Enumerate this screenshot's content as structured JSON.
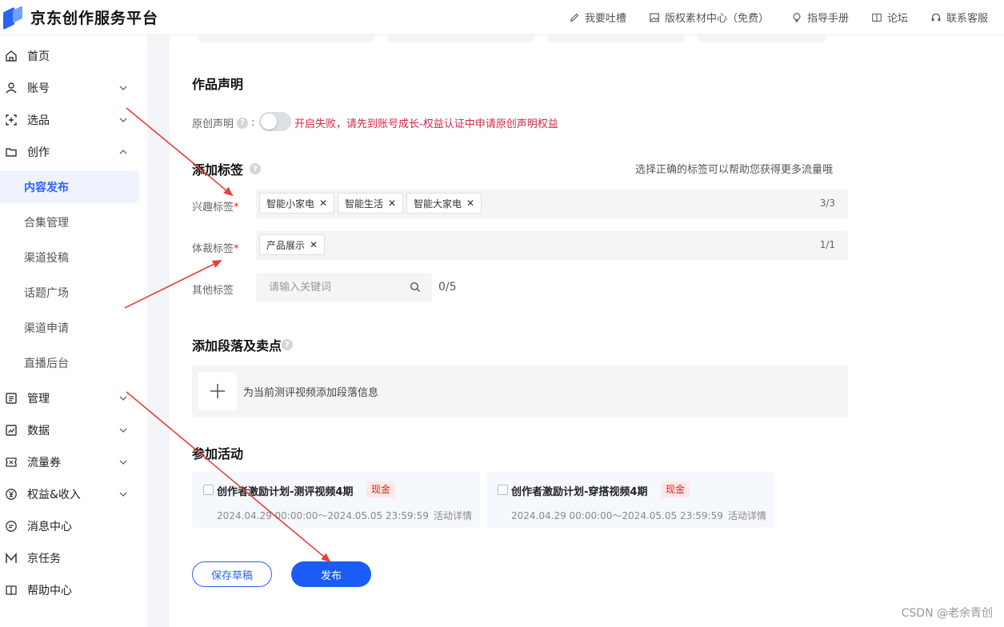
{
  "header": {
    "logo_text": "京东创作服务平台",
    "nav": [
      {
        "icon": "pencil-icon",
        "label": "我要吐槽"
      },
      {
        "icon": "image-icon",
        "label": "版权素材中心（免费）"
      },
      {
        "icon": "bulb-icon",
        "label": "指导手册"
      },
      {
        "icon": "book-icon",
        "label": "论坛"
      },
      {
        "icon": "headset-icon",
        "label": "联系客服"
      }
    ]
  },
  "sidebar": {
    "items": [
      {
        "label": "首页",
        "icon": "home-icon"
      },
      {
        "label": "账号",
        "icon": "user-icon"
      },
      {
        "label": "选品",
        "icon": "scan-icon"
      },
      {
        "label": "创作",
        "icon": "folder-icon"
      },
      {
        "label": "管理",
        "icon": "list-icon"
      },
      {
        "label": "数据",
        "icon": "chart-icon"
      },
      {
        "label": "流量券",
        "icon": "ticket-icon"
      },
      {
        "label": "权益&收入",
        "icon": "yen-icon"
      },
      {
        "label": "消息中心",
        "icon": "message-icon"
      },
      {
        "label": "京任务",
        "icon": "m-icon"
      },
      {
        "label": "帮助中心",
        "icon": "book-icon"
      }
    ],
    "sub_items": [
      "内容发布",
      "合集管理",
      "渠道投稿",
      "话题广场",
      "渠道申请",
      "直播后台"
    ]
  },
  "declaration": {
    "title": "作品声明",
    "original_label": "原创声明",
    "colon": ":",
    "warning": "开启失败，请先到账号成长-权益认证中申请原创声明权益"
  },
  "tags": {
    "title": "添加标签",
    "hint": "选择正确的标签可以帮助您获得更多流量哦",
    "interest_label": "兴趣标签",
    "interest_tags": [
      "智能小家电",
      "智能生活",
      "智能大家电"
    ],
    "interest_count": "3/3",
    "genre_label": "体裁标签",
    "genre_tags": [
      "产品展示"
    ],
    "genre_count": "1/1",
    "other_label": "其他标签",
    "other_placeholder": "请输入关键词",
    "other_count": "0/5",
    "required_mark": "*",
    "remove_glyph": "✕"
  },
  "paragraph": {
    "title": "添加段落及卖点",
    "add_text": "为当前测评视频添加段落信息"
  },
  "activity": {
    "title": "参加活动",
    "cards": [
      {
        "title": "创作者激励计划-测评视频4期",
        "badge": "现金",
        "date": "2024.04.29 00:00:00～2024.05.05 23:59:59",
        "detail": "活动详情"
      },
      {
        "title": "创作者激励计划-穿搭视频4期",
        "badge": "现金",
        "date": "2024.04.29 00:00:00～2024.05.05 23:59:59",
        "detail": "活动详情"
      }
    ]
  },
  "actions": {
    "draft": "保存草稿",
    "publish": "发布"
  },
  "watermark": "CSDN @老余青创",
  "colors": {
    "accent": "#1a5cf5",
    "warning": "#d0294a",
    "required": "#e2231a",
    "annotation_arrow": "#e8403a"
  }
}
